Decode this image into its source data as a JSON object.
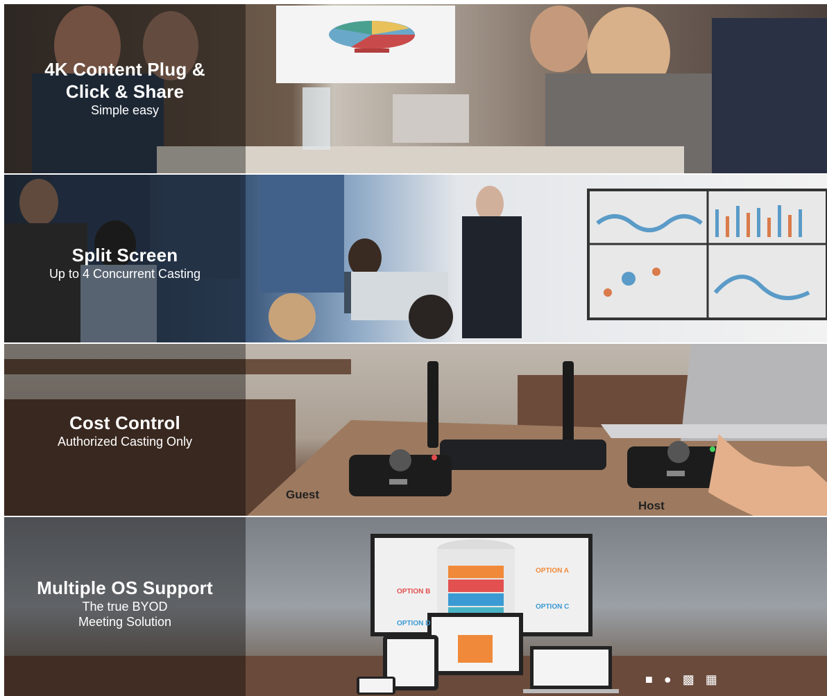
{
  "sections": [
    {
      "title": "4K Content Plug & Click  & Share",
      "subtitle": "Simple easy"
    },
    {
      "title": "Split Screen",
      "subtitle": "Up to 4 Concurrent Casting"
    },
    {
      "title": "Cost Control",
      "subtitle": "Authorized Casting Only"
    },
    {
      "title": "Multiple OS Support",
      "subtitle_line1": "The true BYOD",
      "subtitle_line2": "Meeting Solution"
    }
  ],
  "device_labels": {
    "guest": "Guest",
    "host": "Host"
  },
  "infographic": {
    "option_a": "OPTION A",
    "option_b": "OPTION B",
    "option_c": "OPTION C",
    "option_d": "OPTION D"
  },
  "os_icons": [
    "android-icon",
    "apple-icon",
    "finder-icon",
    "windows-icon"
  ]
}
